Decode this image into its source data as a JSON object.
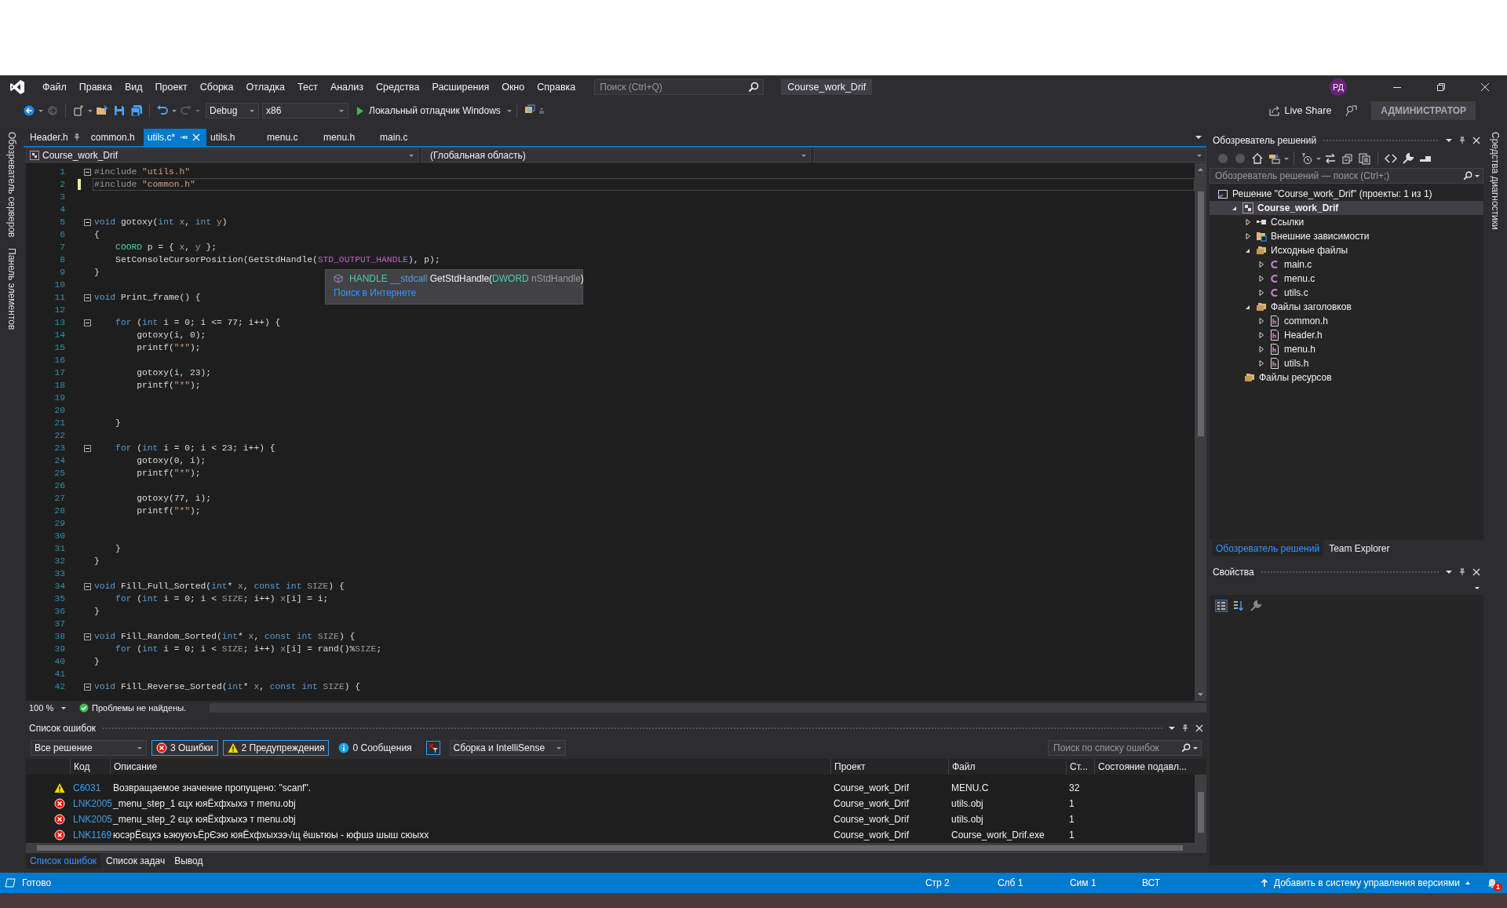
{
  "menu_bar": {
    "items": [
      "Файл",
      "Правка",
      "Вид",
      "Проект",
      "Сборка",
      "Отладка",
      "Тест",
      "Анализ",
      "Средства",
      "Расширения",
      "Окно",
      "Справка"
    ],
    "search": {
      "placeholder": "Поиск (Ctrl+Q)"
    },
    "title": "Course_work_Drif",
    "avatar": "РД"
  },
  "toolbar": {
    "configuration": "Debug",
    "platform": "x86",
    "debugger": "Локальный отладчик Windows",
    "live_share": "Live Share",
    "account": "АДМИНИСТРАТОР"
  },
  "side_tabs_left": [
    "Обозреватель серверов",
    "Панель элементов"
  ],
  "side_tabs_right": [
    "Средства диагностики"
  ],
  "editor_tabs": [
    {
      "label": "Header.h",
      "selected": false,
      "pinned": true
    },
    {
      "label": "common.h",
      "selected": false,
      "pinned": false
    },
    {
      "label": "utils.c*",
      "selected": true,
      "pinned": false
    },
    {
      "label": "utils.h",
      "selected": false,
      "pinned": false
    },
    {
      "label": "menu.c",
      "selected": false,
      "pinned": false
    },
    {
      "label": "menu.h",
      "selected": false,
      "pinned": false
    },
    {
      "label": "main.c",
      "selected": false,
      "pinned": false
    }
  ],
  "nav_bar": {
    "project": "Course_work_Drif",
    "scope": "(Глобальная область)"
  },
  "editor": {
    "lines": [
      {
        "n": "1",
        "fold": true,
        "current": false,
        "modified": false,
        "tokens": [
          {
            "kind": "pp",
            "text": "#include"
          },
          {
            "kind": "str",
            "text": " \"utils.h\""
          }
        ]
      },
      {
        "n": "2",
        "fold": false,
        "current": true,
        "modified": true,
        "tokens": [
          {
            "kind": "pp",
            "text": "#include"
          },
          {
            "kind": "str",
            "text": " \"common.h\""
          }
        ]
      },
      {
        "n": "3",
        "fold": false,
        "current": false,
        "modified": false
      },
      {
        "n": "4",
        "fold": false,
        "current": false,
        "modified": false
      },
      {
        "n": "5",
        "fold": true,
        "current": false,
        "modified": false,
        "tokens": [
          {
            "kind": "kw",
            "text": "void"
          },
          {
            "kind": "p",
            "text": " gotoxy("
          },
          {
            "kind": "kw",
            "text": "int"
          },
          {
            "kind": "prm",
            "text": " x"
          },
          {
            "kind": "p",
            "text": ", "
          },
          {
            "kind": "kw",
            "text": "int"
          },
          {
            "kind": "prm",
            "text": " y"
          },
          {
            "kind": "p",
            "text": ")"
          }
        ]
      },
      {
        "n": "6",
        "fold": false,
        "current": false,
        "modified": false,
        "tokens": [
          {
            "kind": "p",
            "text": "{"
          }
        ]
      },
      {
        "n": "7",
        "fold": false,
        "current": false,
        "modified": false,
        "tokens": [
          {
            "kind": "ty",
            "text": "    COORD"
          },
          {
            "kind": "p",
            "text": " p = { "
          },
          {
            "kind": "prm",
            "text": "x"
          },
          {
            "kind": "p",
            "text": ", "
          },
          {
            "kind": "prm",
            "text": "y"
          },
          {
            "kind": "p",
            "text": " };"
          }
        ]
      },
      {
        "n": "8",
        "fold": false,
        "current": false,
        "modified": false,
        "tokens": [
          {
            "kind": "p",
            "text": "    SetConsoleCursorPosition(GetStdHandle("
          },
          {
            "kind": "mac",
            "text": "STD_OUTPUT_HANDLE"
          },
          {
            "kind": "p",
            "text": "), p);"
          }
        ]
      },
      {
        "n": "9",
        "fold": false,
        "current": false,
        "modified": false,
        "tokens": [
          {
            "kind": "p",
            "text": "}"
          }
        ]
      },
      {
        "n": "10",
        "fold": false,
        "current": false,
        "modified": false
      },
      {
        "n": "11",
        "fold": true,
        "current": false,
        "modified": false,
        "tokens": [
          {
            "kind": "kw",
            "text": "void"
          },
          {
            "kind": "p",
            "text": " Print_frame() {"
          }
        ]
      },
      {
        "n": "12",
        "fold": false,
        "current": false,
        "modified": false
      },
      {
        "n": "13",
        "fold": true,
        "current": false,
        "modified": false,
        "tokens": [
          {
            "kind": "kw",
            "text": "    for"
          },
          {
            "kind": "p",
            "text": " ("
          },
          {
            "kind": "kw",
            "text": "int"
          },
          {
            "kind": "p",
            "text": " i = 0; i <= 77; i++) {"
          }
        ]
      },
      {
        "n": "14",
        "fold": false,
        "current": false,
        "modified": false,
        "tokens": [
          {
            "kind": "p",
            "text": "        gotoxy(i, 0);"
          }
        ]
      },
      {
        "n": "15",
        "fold": false,
        "current": false,
        "modified": false,
        "tokens": [
          {
            "kind": "p",
            "text": "        printf("
          },
          {
            "kind": "str",
            "text": "\"*\""
          },
          {
            "kind": "p",
            "text": ");"
          }
        ]
      },
      {
        "n": "16",
        "fold": false,
        "current": false,
        "modified": false
      },
      {
        "n": "17",
        "fold": false,
        "current": false,
        "modified": false,
        "tokens": [
          {
            "kind": "p",
            "text": "        gotoxy(i, 23);"
          }
        ]
      },
      {
        "n": "18",
        "fold": false,
        "current": false,
        "modified": false,
        "tokens": [
          {
            "kind": "p",
            "text": "        printf("
          },
          {
            "kind": "str",
            "text": "\"*\""
          },
          {
            "kind": "p",
            "text": ");"
          }
        ]
      },
      {
        "n": "19",
        "fold": false,
        "current": false,
        "modified": false
      },
      {
        "n": "20",
        "fold": false,
        "current": false,
        "modified": false
      },
      {
        "n": "21",
        "fold": false,
        "current": false,
        "modified": false,
        "tokens": [
          {
            "kind": "p",
            "text": "    }"
          }
        ]
      },
      {
        "n": "22",
        "fold": false,
        "current": false,
        "modified": false
      },
      {
        "n": "23",
        "fold": true,
        "current": false,
        "modified": false,
        "tokens": [
          {
            "kind": "kw",
            "text": "    for"
          },
          {
            "kind": "p",
            "text": " ("
          },
          {
            "kind": "kw",
            "text": "int"
          },
          {
            "kind": "p",
            "text": " i = 0; i < 23; i++) {"
          }
        ]
      },
      {
        "n": "24",
        "fold": false,
        "current": false,
        "modified": false,
        "tokens": [
          {
            "kind": "p",
            "text": "        gotoxy(0, i);"
          }
        ]
      },
      {
        "n": "25",
        "fold": false,
        "current": false,
        "modified": false,
        "tokens": [
          {
            "kind": "p",
            "text": "        printf("
          },
          {
            "kind": "str",
            "text": "\"*\""
          },
          {
            "kind": "p",
            "text": ");"
          }
        ]
      },
      {
        "n": "26",
        "fold": false,
        "current": false,
        "modified": false
      },
      {
        "n": "27",
        "fold": false,
        "current": false,
        "modified": false,
        "tokens": [
          {
            "kind": "p",
            "text": "        gotoxy(77, i);"
          }
        ]
      },
      {
        "n": "28",
        "fold": false,
        "current": false,
        "modified": false,
        "tokens": [
          {
            "kind": "p",
            "text": "        printf("
          },
          {
            "kind": "str",
            "text": "\"*\""
          },
          {
            "kind": "p",
            "text": ");"
          }
        ]
      },
      {
        "n": "29",
        "fold": false,
        "current": false,
        "modified": false
      },
      {
        "n": "30",
        "fold": false,
        "current": false,
        "modified": false
      },
      {
        "n": "31",
        "fold": false,
        "current": false,
        "modified": false,
        "tokens": [
          {
            "kind": "p",
            "text": "    }"
          }
        ]
      },
      {
        "n": "32",
        "fold": false,
        "current": false,
        "modified": false,
        "tokens": [
          {
            "kind": "p",
            "text": "}"
          }
        ]
      },
      {
        "n": "33",
        "fold": false,
        "current": false,
        "modified": false
      },
      {
        "n": "34",
        "fold": true,
        "current": false,
        "modified": false,
        "tokens": [
          {
            "kind": "kw",
            "text": "void"
          },
          {
            "kind": "p",
            "text": " Fill_Full_Sorted("
          },
          {
            "kind": "kw",
            "text": "int"
          },
          {
            "kind": "p",
            "text": "*"
          },
          {
            "kind": "prm",
            "text": " x"
          },
          {
            "kind": "p",
            "text": ", "
          },
          {
            "kind": "kw",
            "text": "const"
          },
          {
            "kind": "kw",
            "text": " int"
          },
          {
            "kind": "prm",
            "text": " SIZE"
          },
          {
            "kind": "p",
            "text": ") {"
          }
        ]
      },
      {
        "n": "35",
        "fold": false,
        "current": false,
        "modified": false,
        "tokens": [
          {
            "kind": "kw",
            "text": "    for"
          },
          {
            "kind": "p",
            "text": " ("
          },
          {
            "kind": "kw",
            "text": "int"
          },
          {
            "kind": "p",
            "text": " i = 0; i < "
          },
          {
            "kind": "prm",
            "text": "SIZE"
          },
          {
            "kind": "p",
            "text": "; i++) "
          },
          {
            "kind": "prm",
            "text": "x"
          },
          {
            "kind": "p",
            "text": "[i] = i;"
          }
        ]
      },
      {
        "n": "36",
        "fold": false,
        "current": false,
        "modified": false,
        "tokens": [
          {
            "kind": "p",
            "text": "}"
          }
        ]
      },
      {
        "n": "37",
        "fold": false,
        "current": false,
        "modified": false
      },
      {
        "n": "38",
        "fold": true,
        "current": false,
        "modified": false,
        "tokens": [
          {
            "kind": "kw",
            "text": "void"
          },
          {
            "kind": "p",
            "text": " Fill_Random_Sorted("
          },
          {
            "kind": "kw",
            "text": "int"
          },
          {
            "kind": "p",
            "text": "*"
          },
          {
            "kind": "prm",
            "text": " x"
          },
          {
            "kind": "p",
            "text": ", "
          },
          {
            "kind": "kw",
            "text": "const"
          },
          {
            "kind": "kw",
            "text": " int"
          },
          {
            "kind": "prm",
            "text": " SIZE"
          },
          {
            "kind": "p",
            "text": ") {"
          }
        ]
      },
      {
        "n": "39",
        "fold": false,
        "current": false,
        "modified": false,
        "tokens": [
          {
            "kind": "kw",
            "text": "    for"
          },
          {
            "kind": "p",
            "text": " ("
          },
          {
            "kind": "kw",
            "text": "int"
          },
          {
            "kind": "p",
            "text": " i = 0; i < "
          },
          {
            "kind": "prm",
            "text": "SIZE"
          },
          {
            "kind": "p",
            "text": "; i++) "
          },
          {
            "kind": "prm",
            "text": "x"
          },
          {
            "kind": "p",
            "text": "[i] = rand()%"
          },
          {
            "kind": "prm",
            "text": "SIZE"
          },
          {
            "kind": "p",
            "text": ";"
          }
        ]
      },
      {
        "n": "40",
        "fold": false,
        "current": false,
        "modified": false,
        "tokens": [
          {
            "kind": "p",
            "text": "}"
          }
        ]
      },
      {
        "n": "41",
        "fold": false,
        "current": false,
        "modified": false
      },
      {
        "n": "42",
        "fold": true,
        "current": false,
        "modified": false,
        "tokens": [
          {
            "kind": "kw",
            "text": "void"
          },
          {
            "kind": "p",
            "text": " Fill_Reverse_Sorted("
          },
          {
            "kind": "kw",
            "text": "int"
          },
          {
            "kind": "p",
            "text": "*"
          },
          {
            "kind": "prm",
            "text": " x"
          },
          {
            "kind": "p",
            "text": ", "
          },
          {
            "kind": "kw",
            "text": "const"
          },
          {
            "kind": "kw",
            "text": " int"
          },
          {
            "kind": "prm",
            "text": " SIZE"
          },
          {
            "kind": "p",
            "text": ") {"
          }
        ]
      }
    ],
    "tooltip": {
      "signature": [
        {
          "kind": "ty",
          "text": "HANDLE"
        },
        {
          "kind": "kw",
          "text": " __stdcall"
        },
        {
          "kind": "p",
          "text": " GetStdHandle("
        },
        {
          "kind": "ty",
          "text": "DWORD"
        },
        {
          "kind": "prm",
          "text": " nStdHandle"
        },
        {
          "kind": "p",
          "text": ")"
        }
      ],
      "link": "Поиск в Интернете"
    },
    "zoom": "100 %",
    "status": "Проблемы не найдены."
  },
  "error_list": {
    "title": "Список ошибок",
    "scope": "Все решение",
    "filters": [
      {
        "kind": "error",
        "label": "3 Ошибки",
        "selected": true
      },
      {
        "kind": "warning",
        "label": "2 Предупреждения",
        "selected": true
      },
      {
        "kind": "info",
        "label": "0 Сообщения",
        "selected": false
      }
    ],
    "source": "Сборка и IntelliSense",
    "search": {
      "placeholder": "Поиск по списку ошибок"
    },
    "columns": [
      "Код",
      "Описание",
      "Проект",
      "Файл",
      "Ст...",
      "Состояние подавл..."
    ],
    "rows": [
      {
        "kind": "warning",
        "code": "C6031",
        "description": "Возвращаемое значение пропущено: \"scanf\".",
        "project": "Course_work_Drif",
        "file": "MENU.C",
        "line": "32"
      },
      {
        "kind": "error",
        "code": "LNK2005",
        "description": "_menu_step_1 єцх юяЁхфхыхэ т menu.obj",
        "project": "Course_work_Drif",
        "file": "utils.obj",
        "line": "1"
      },
      {
        "kind": "error",
        "code": "LNK2005",
        "description": "_menu_step_2 єцх юяЁхфхыхэ т menu.obj",
        "project": "Course_work_Drif",
        "file": "utils.obj",
        "line": "1"
      },
      {
        "kind": "error",
        "code": "LNK1169",
        "description": "юсэрЁєцхэ ьэюуюъЁрЄэю юяЁхфхыхээ√щ ёшьтюы - юфшэ шыш сюыхх",
        "project": "Course_work_Drif",
        "file": "Course_work_Drif.exe",
        "line": "1"
      }
    ]
  },
  "bottom_tabs": [
    {
      "label": "Список ошибок",
      "selected": true
    },
    {
      "label": "Список задач",
      "selected": false
    },
    {
      "label": "Вывод",
      "selected": false
    }
  ],
  "solution_explorer": {
    "title": "Обозреватель решений",
    "search": {
      "placeholder": "Обозреватель решений — поиск (Ctrl+;)"
    },
    "tree": [
      {
        "label": "Решение \"Course_work_Drif\" (проекты: 1 из 1)",
        "kind": "solution",
        "expandable": false,
        "selected": false,
        "children": [
          {
            "label": "Course_work_Drif",
            "kind": "project",
            "expandable": true,
            "expanded": true,
            "selected": true,
            "children": [
              {
                "label": "Ссылки",
                "kind": "refs",
                "expandable": true,
                "expanded": false,
                "selected": false
              },
              {
                "label": "Внешние зависимости",
                "kind": "deps",
                "expandable": true,
                "expanded": false,
                "selected": false
              },
              {
                "label": "Исходные файлы",
                "kind": "folder",
                "expandable": true,
                "expanded": true,
                "selected": false,
                "children": [
                  {
                    "label": "main.c",
                    "kind": "c",
                    "expandable": true,
                    "expanded": false,
                    "selected": false
                  },
                  {
                    "label": "menu.c",
                    "kind": "c",
                    "expandable": true,
                    "expanded": false,
                    "selected": false
                  },
                  {
                    "label": "utils.c",
                    "kind": "c",
                    "expandable": true,
                    "expanded": false,
                    "selected": false
                  }
                ]
              },
              {
                "label": "Файлы заголовков",
                "kind": "folder",
                "expandable": true,
                "expanded": true,
                "selected": false,
                "children": [
                  {
                    "label": "common.h",
                    "kind": "h",
                    "expandable": true,
                    "expanded": false,
                    "selected": false
                  },
                  {
                    "label": "Header.h",
                    "kind": "h",
                    "expandable": true,
                    "expanded": false,
                    "selected": false
                  },
                  {
                    "label": "menu.h",
                    "kind": "h",
                    "expandable": true,
                    "expanded": false,
                    "selected": false
                  },
                  {
                    "label": "utils.h",
                    "kind": "h",
                    "expandable": true,
                    "expanded": false,
                    "selected": false
                  }
                ]
              },
              {
                "label": "Файлы ресурсов",
                "kind": "folder",
                "expandable": false,
                "selected": false
              }
            ]
          }
        ]
      }
    ],
    "tabs": [
      {
        "label": "Обозреватель решений",
        "selected": true
      },
      {
        "label": "Team Explorer",
        "selected": false
      }
    ]
  },
  "properties": {
    "title": "Свойства"
  },
  "status_bar": {
    "state": "Готово",
    "line": "Стр 2",
    "column": "Слб 1",
    "char": "Сим 1",
    "mode": "ВСТ",
    "source_control": "Добавить в систему управления версиями",
    "notifications": "1"
  }
}
